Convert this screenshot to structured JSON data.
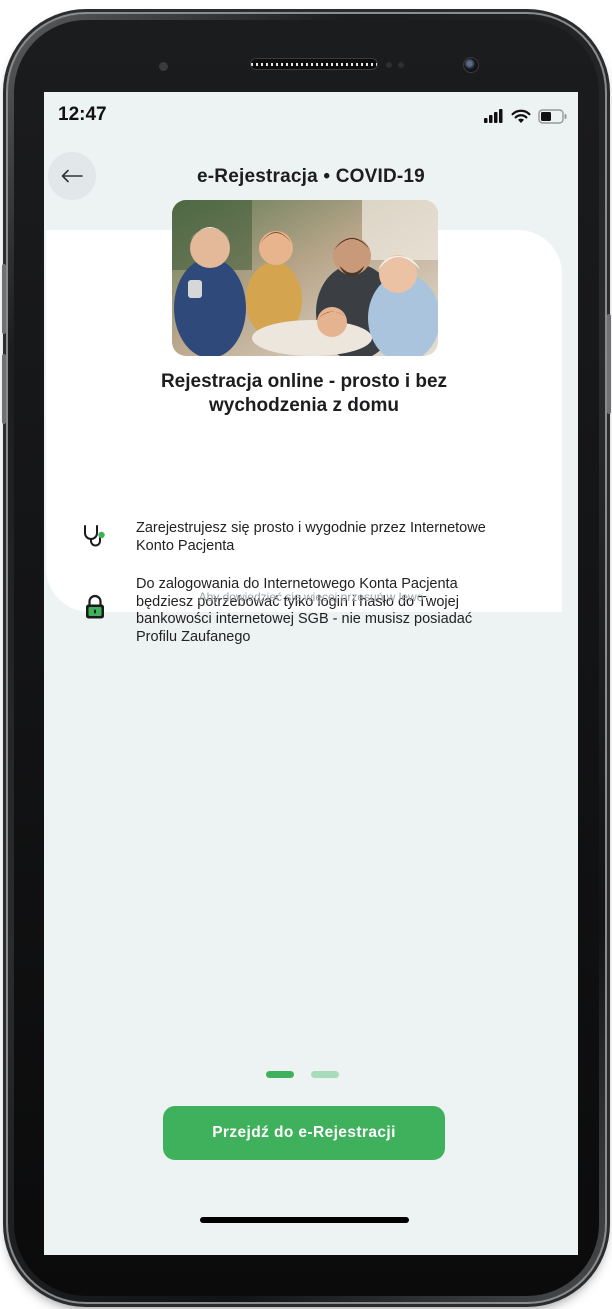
{
  "status_bar": {
    "time": "12:47",
    "icons": [
      "signal-icon",
      "wifi-icon",
      "battery-icon"
    ]
  },
  "header": {
    "back_icon": "arrow-left-icon",
    "title": "e-Rejestracja • COVID-19"
  },
  "card": {
    "image": "family-photo",
    "title": "Rejestracja online - prosto i bez wychodzenia z domu",
    "features": [
      {
        "icon": "stethoscope-icon",
        "text": "Zarejestrujesz się prosto i wygodnie przez Internetowe Konto Pacjenta"
      },
      {
        "icon": "lock-icon",
        "text": "Do zalogowania do Internetowego Konta Pacjenta będziesz potrzebować tylko login i hasło do Twojej bankowości internetowej SGB - nie musisz posiadać Profilu Zaufanego"
      }
    ],
    "hint": "Aby dowiedzieć się więcej przesuń w lewo"
  },
  "pager": {
    "count": 2,
    "active": 1
  },
  "cta": {
    "label": "Przejdź do e-Rejestracji"
  },
  "colors": {
    "accent": "#3fb05c",
    "screen_bg": "#edf2f3",
    "dot_inactive": "#a8dbb8",
    "icon_green": "#2f8a47"
  }
}
